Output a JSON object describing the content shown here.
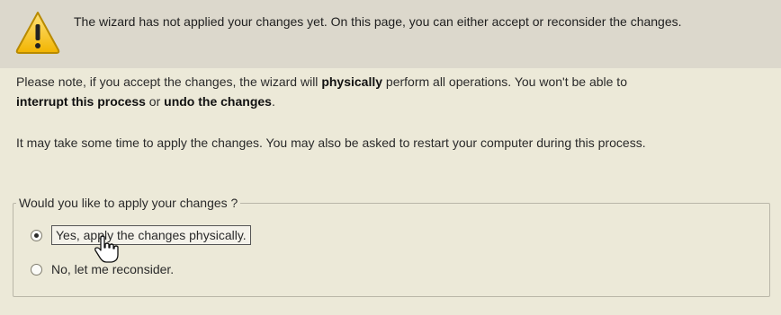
{
  "warning": {
    "icon": "warning-icon",
    "text": "The wizard has not applied your changes yet. On this page, you can either accept or reconsider the changes."
  },
  "note": {
    "prefix": "Please note, if you accept the changes, the wizard will ",
    "bold1": "physically",
    "middle": " perform all operations. You won't be able to ",
    "bold2": "interrupt this process",
    "or": " or ",
    "bold3": "undo the changes",
    "end": "."
  },
  "time_note": "It may take some time to apply the changes. You may also be asked to restart your computer during this process.",
  "group": {
    "legend": "Would you like to apply your changes ?",
    "options": [
      {
        "label": "Yes, apply the changes physically.",
        "checked": true
      },
      {
        "label": "No, let me reconsider.",
        "checked": false
      }
    ]
  },
  "cursor": {
    "icon": "hand-cursor-icon"
  }
}
